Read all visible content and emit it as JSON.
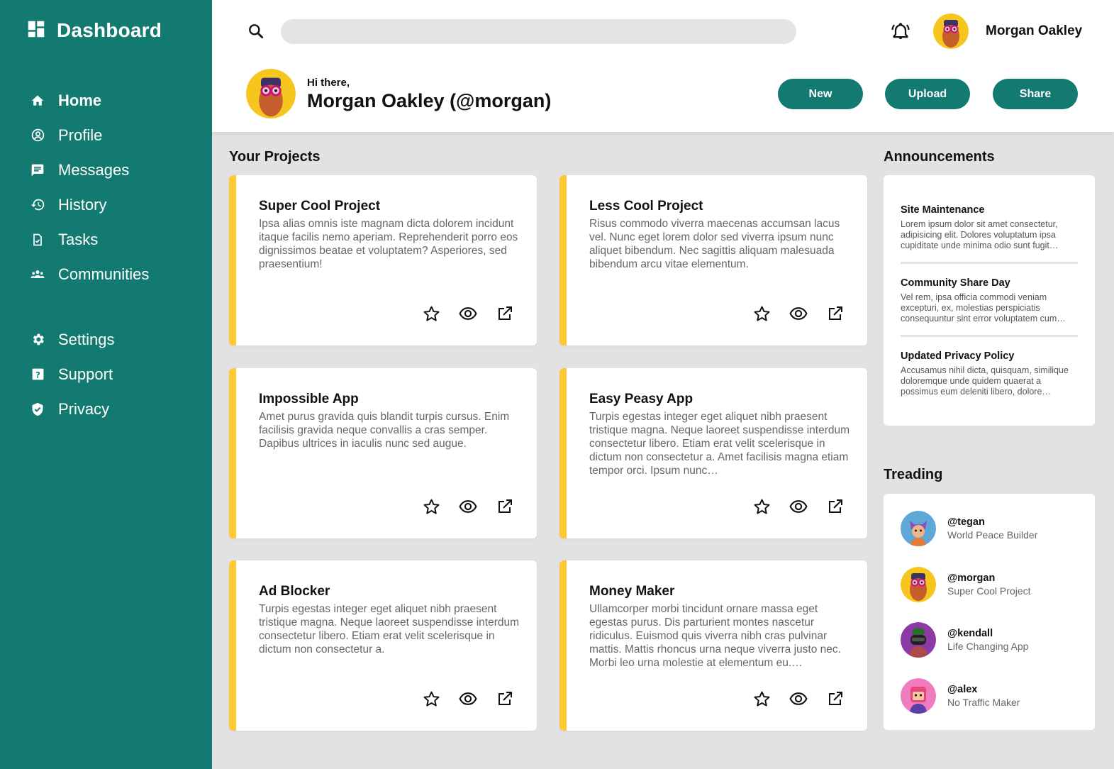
{
  "colors": {
    "brand": "#137a72",
    "accent": "#fdcb31",
    "background": "#e2e2e5"
  },
  "brand": {
    "title": "Dashboard",
    "icon": "dashboard-icon"
  },
  "nav": {
    "main": [
      {
        "label": "Home",
        "icon": "home-icon",
        "active": true
      },
      {
        "label": "Profile",
        "icon": "profile-icon"
      },
      {
        "label": "Messages",
        "icon": "messages-icon"
      },
      {
        "label": "History",
        "icon": "history-icon"
      },
      {
        "label": "Tasks",
        "icon": "tasks-icon"
      },
      {
        "label": "Communities",
        "icon": "communities-icon"
      }
    ],
    "secondary": [
      {
        "label": "Settings",
        "icon": "gear-icon"
      },
      {
        "label": "Support",
        "icon": "support-icon"
      },
      {
        "label": "Privacy",
        "icon": "shield-icon"
      }
    ]
  },
  "header": {
    "search": {
      "value": "",
      "placeholder": ""
    },
    "user_name": "Morgan Oakley",
    "greeting": "Hi there,",
    "greeting_name": "Morgan Oakley (@morgan)",
    "buttons": {
      "new": "New",
      "upload": "Upload",
      "share": "Share"
    }
  },
  "projects": {
    "title": "Your Projects",
    "items": [
      {
        "title": "Super Cool Project",
        "description": "Ipsa alias omnis iste magnam dicta dolorem incidunt itaque facilis nemo aperiam. Reprehenderit porro eos dignissimos beatae et voluptatem? Asperiores, sed praesentium!"
      },
      {
        "title": "Less Cool Project",
        "description": "Risus commodo viverra maecenas accumsan lacus vel. Nunc eget lorem dolor sed viverra ipsum nunc aliquet bibendum. Nec sagittis aliquam malesuada bibendum arcu vitae elementum."
      },
      {
        "title": "Impossible App",
        "description": "Amet purus gravida quis blandit turpis cursus. Enim facilisis gravida neque convallis a cras semper. Dapibus ultrices in iaculis nunc sed augue."
      },
      {
        "title": "Easy Peasy App",
        "description": "Turpis egestas integer eget aliquet nibh praesent tristique magna. Neque laoreet suspendisse interdum consectetur libero. Etiam erat velit scelerisque in dictum non consectetur a. Amet facilisis magna etiam tempor orci. Ipsum nunc…"
      },
      {
        "title": "Ad Blocker",
        "description": "Turpis egestas integer eget aliquet nibh praesent tristique magna. Neque laoreet suspendisse interdum consectetur libero. Etiam erat velit scelerisque in dictum non consectetur a."
      },
      {
        "title": "Money Maker",
        "description": "Ullamcorper morbi tincidunt ornare massa eget egestas purus. Dis parturient montes nascetur ridiculus. Euismod quis viverra nibh cras pulvinar mattis. Mattis rhoncus urna neque viverra justo nec. Morbi leo urna molestie at elementum eu.…"
      }
    ]
  },
  "announcements": {
    "title": "Announcements",
    "items": [
      {
        "title": "Site Maintenance",
        "description": "Lorem ipsum dolor sit amet consectetur, adipisicing elit. Dolores voluptatum ipsa cupiditate unde minima odio sunt fugit…"
      },
      {
        "title": "Community Share Day",
        "description": "Vel rem, ipsa officia commodi veniam excepturi, ex, molestias perspiciatis consequuntur sint error voluptatem cum…"
      },
      {
        "title": "Updated Privacy Policy",
        "description": "Accusamus nihil dicta, quisquam, similique doloremque unde quidem quaerat a possimus eum deleniti libero, dolore…"
      }
    ]
  },
  "trending": {
    "title": "Treading",
    "items": [
      {
        "handle": "@tegan",
        "project": "World Peace Builder"
      },
      {
        "handle": "@morgan",
        "project": "Super Cool Project"
      },
      {
        "handle": "@kendall",
        "project": "Life Changing App"
      },
      {
        "handle": "@alex",
        "project": "No Traffic Maker"
      }
    ]
  }
}
